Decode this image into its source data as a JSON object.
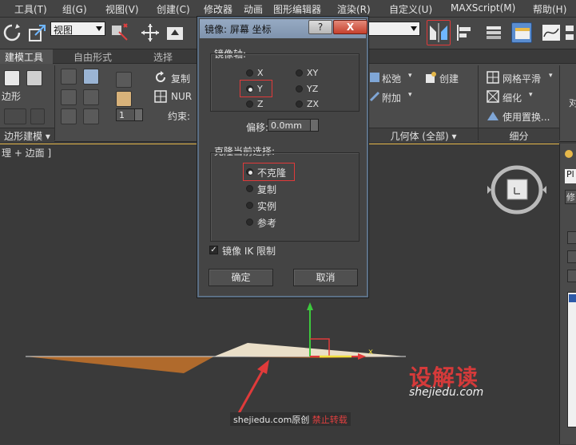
{
  "menubar": {
    "items": [
      "工具(T)",
      "组(G)",
      "视图(V)",
      "创建(C)",
      "修改器",
      "动画",
      "图形编辑器",
      "渲染(R)",
      "自定义(U)",
      "MAXScript(M)",
      "帮助(H)"
    ]
  },
  "toolbar": {
    "viewport_combo": "视图"
  },
  "ribbon": {
    "tabs": [
      "建模工具",
      "自由形式",
      "选择"
    ],
    "labels": {
      "poly": "边形",
      "fu_zhi": "复制",
      "nur": "NUR",
      "yue_shu": "约束:",
      "count": "1",
      "song_chi": "松弛",
      "chuang_jian": "创建",
      "fu_jia": "附加",
      "wang_ge": "网格平滑",
      "xi_hua": "细化",
      "shi_yong": "使用置换...",
      "dui": "对"
    },
    "sections": [
      "边形建模",
      "几何体 (全部)",
      "细分"
    ]
  },
  "viewport": {
    "label": "理 + 边面 ]",
    "axis_label": "x"
  },
  "command_panel": {
    "pl": "Pl",
    "xiu": "修"
  },
  "dialog": {
    "title": "镜像: 屏幕 坐标",
    "help_label": "?",
    "close_label": "X",
    "mirror_axis": {
      "title": "镜像轴:",
      "options": [
        "X",
        "XY",
        "Y",
        "YZ",
        "Z",
        "ZX"
      ],
      "selected": "Y"
    },
    "offset": {
      "label": "偏移:",
      "value": "0.0mm"
    },
    "clone": {
      "title": "克隆当前选择:",
      "options": [
        "不克隆",
        "复制",
        "实例",
        "参考"
      ],
      "selected": "不克隆"
    },
    "mirror_ik": {
      "label": "镜像 IK 限制",
      "checked": true,
      "mark": "✓"
    },
    "ok_label": "确定",
    "cancel_label": "取消"
  },
  "watermark": {
    "brand": "设解读",
    "site": "shejiedu.com",
    "note_prefix": "shejiedu.com原创",
    "note_suffix": "禁止转载"
  }
}
